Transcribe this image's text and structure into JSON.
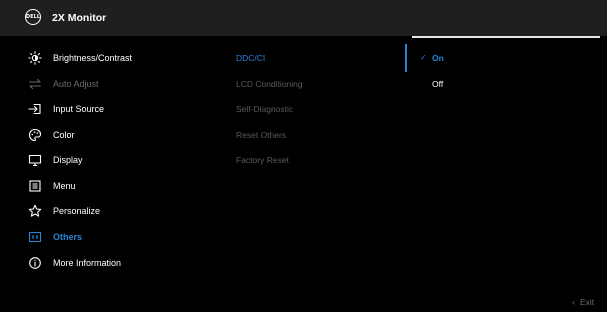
{
  "header": {
    "logo_text": "DELL",
    "title": "2X Monitor"
  },
  "menu": {
    "items": [
      {
        "label": "Brightness/Contrast",
        "icon": "brightness-icon",
        "state": "normal"
      },
      {
        "label": "Auto Adjust",
        "icon": "auto-adjust-icon",
        "state": "disabled"
      },
      {
        "label": "Input Source",
        "icon": "input-source-icon",
        "state": "normal"
      },
      {
        "label": "Color",
        "icon": "color-palette-icon",
        "state": "normal"
      },
      {
        "label": "Display",
        "icon": "display-icon",
        "state": "normal"
      },
      {
        "label": "Menu",
        "icon": "menu-icon",
        "state": "normal"
      },
      {
        "label": "Personalize",
        "icon": "star-icon",
        "state": "normal"
      },
      {
        "label": "Others",
        "icon": "others-icon",
        "state": "active"
      },
      {
        "label": "More Information",
        "icon": "info-icon",
        "state": "normal"
      }
    ]
  },
  "submenu": {
    "items": [
      {
        "label": "DDC/CI",
        "state": "active"
      },
      {
        "label": "LCD Conditioning",
        "state": "normal"
      },
      {
        "label": "Self-Diagnostic",
        "state": "normal"
      },
      {
        "label": "Reset Others",
        "state": "normal"
      },
      {
        "label": "Factory Reset",
        "state": "normal"
      }
    ]
  },
  "options": {
    "items": [
      {
        "label": "On",
        "selected": true
      },
      {
        "label": "Off",
        "selected": false
      }
    ],
    "check_glyph": "✓"
  },
  "footer": {
    "exit_label": "Exit",
    "exit_icon": "chevron-left-icon"
  },
  "colors": {
    "accent": "#2a82d8",
    "header_bg": "#1f1f1f",
    "background": "#000000",
    "dim_text": "#6a6a6a"
  }
}
